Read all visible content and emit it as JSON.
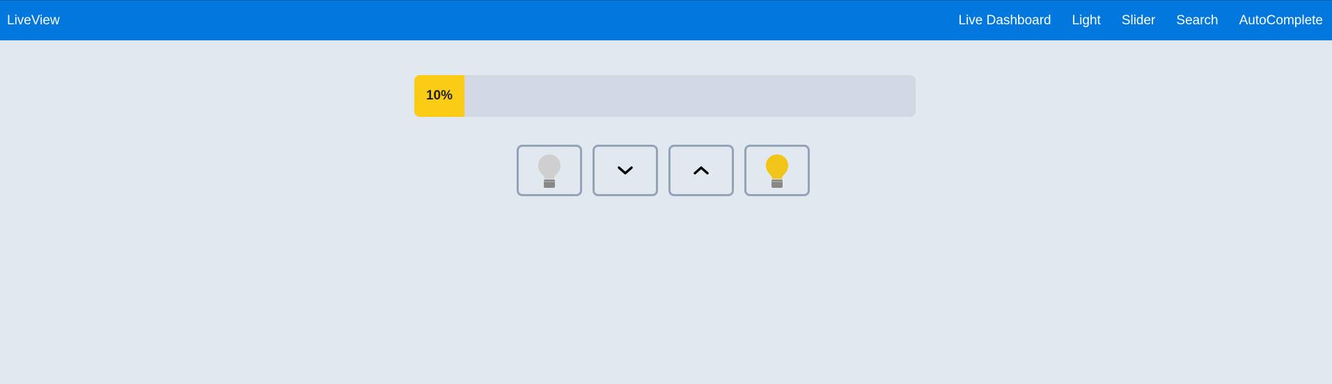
{
  "navbar": {
    "brand": "LiveView",
    "links": [
      "Live Dashboard",
      "Light",
      "Slider",
      "Search",
      "AutoComplete"
    ]
  },
  "light": {
    "brightness_percent": 10,
    "brightness_label": "10%"
  },
  "controls": [
    {
      "icon": "lightbulb-off-icon"
    },
    {
      "icon": "chevron-down-icon"
    },
    {
      "icon": "chevron-up-icon"
    },
    {
      "icon": "lightbulb-on-icon"
    }
  ],
  "colors": {
    "navbar_bg": "#0277dd",
    "page_bg": "#e2e8f0",
    "progress_fill": "#facc15",
    "progress_track": "#d1d8e3",
    "bulb_on": "#f0c419",
    "bulb_off": "#cfcfcf"
  }
}
